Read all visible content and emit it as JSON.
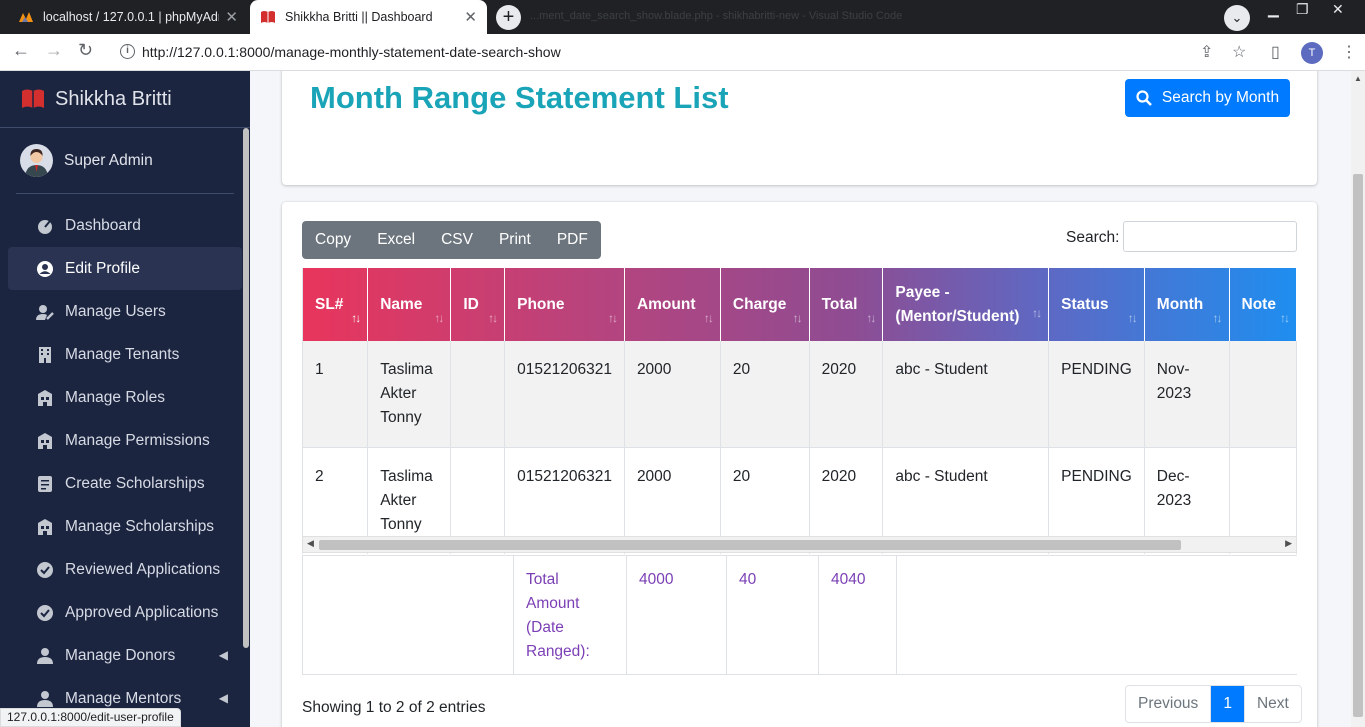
{
  "browser": {
    "tabs": [
      {
        "title": "localhost / 127.0.0.1 | phpMyAdm",
        "active": false
      },
      {
        "title": "Shikkha Britti || Dashboard",
        "active": true
      }
    ],
    "ghost_title": "...ment_date_search_show.blade.php - shikhabritti-new - Visual Studio Code",
    "url": "http://127.0.0.1:8000/manage-monthly-statement-date-search-show",
    "profile_initial": "T",
    "status_url": "127.0.0.1:8000/edit-user-profile"
  },
  "sidebar": {
    "brand": "Shikkha Britti",
    "user": "Super Admin",
    "items": [
      {
        "label": "Dashboard",
        "icon": "dashboard-icon"
      },
      {
        "label": "Edit Profile",
        "icon": "user-circle-icon",
        "active": true
      },
      {
        "label": "Manage Users",
        "icon": "user-edit-icon"
      },
      {
        "label": "Manage Tenants",
        "icon": "building-icon"
      },
      {
        "label": "Manage Roles",
        "icon": "roles-icon"
      },
      {
        "label": "Manage Permissions",
        "icon": "permissions-icon"
      },
      {
        "label": "Create Scholarships",
        "icon": "document-icon"
      },
      {
        "label": "Manage Scholarships",
        "icon": "scholarship-icon"
      },
      {
        "label": "Reviewed Applications",
        "icon": "check-circle-icon"
      },
      {
        "label": "Approved Applications",
        "icon": "check-circle-icon"
      },
      {
        "label": "Manage Donors",
        "icon": "donor-icon"
      },
      {
        "label": "Manage Mentors",
        "icon": "mentor-icon"
      }
    ]
  },
  "page": {
    "title": "Month Range Statement List",
    "search_button": "Search by Month"
  },
  "export_buttons": [
    "Copy",
    "Excel",
    "CSV",
    "Print",
    "PDF"
  ],
  "search_label": "Search:",
  "table": {
    "columns": [
      "SL#",
      "Name",
      "ID",
      "Phone",
      "Amount",
      "Charge",
      "Total",
      "Payee - (Mentor/Student)",
      "Status",
      "Month",
      "Note"
    ],
    "rows": [
      {
        "sl": "1",
        "name": "Taslima Akter Tonny",
        "id": "",
        "phone": "01521206321",
        "amount": "2000",
        "charge": "20",
        "total": "2020",
        "payee": "abc - Student",
        "status": "PENDING",
        "month": "Nov-2023",
        "note": ""
      },
      {
        "sl": "2",
        "name": "Taslima Akter Tonny",
        "id": "",
        "phone": "01521206321",
        "amount": "2000",
        "charge": "20",
        "total": "2020",
        "payee": "abc - Student",
        "status": "PENDING",
        "month": "Dec-2023",
        "note": ""
      }
    ],
    "footer": {
      "label": "Total Amount (Date Ranged):",
      "amount": "4000",
      "charge": "40",
      "total": "4040"
    }
  },
  "info": "Showing 1 to 2 of 2 entries",
  "pagination": {
    "previous": "Previous",
    "current": "1",
    "next": "Next"
  },
  "colors": {
    "title": "#1aa4b8",
    "primary": "#007bff",
    "sidebar": "#1c2540",
    "footer_text": "#7b3fb5"
  }
}
